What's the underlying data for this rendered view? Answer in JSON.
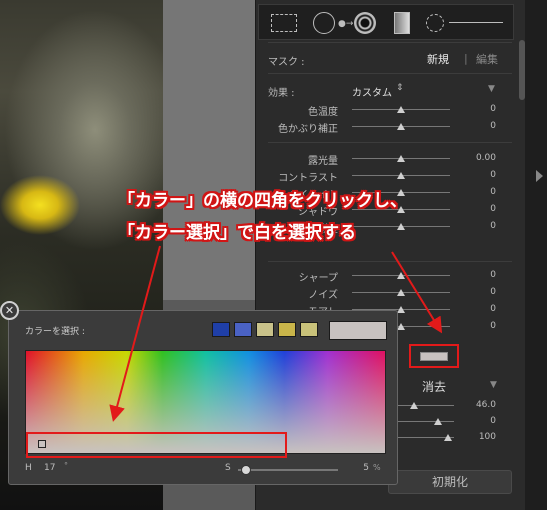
{
  "mask": {
    "label": "マスク :",
    "new": "新規",
    "separator": "|",
    "edit": "編集"
  },
  "effect": {
    "label": "効果 :",
    "value": "カスタム",
    "arrows": "⇕",
    "collapse": "▼",
    "rows": [
      {
        "label": "色温度",
        "value": "0",
        "pos": 0.5
      },
      {
        "label": "色かぶり補正",
        "value": "0",
        "pos": 0.5
      }
    ]
  },
  "tone": {
    "rows": [
      {
        "label": "露光量",
        "value": "0.00",
        "pos": 0.5
      },
      {
        "label": "コントラスト",
        "value": "0",
        "pos": 0.5
      },
      {
        "label": "ハイライト",
        "value": "0",
        "pos": 0.5
      },
      {
        "label": "シャドウ",
        "value": "0",
        "pos": 0.5
      },
      {
        "label": "彩度",
        "value": "0",
        "pos": 0.5
      }
    ]
  },
  "detail": {
    "rows": [
      {
        "label": "シャープ",
        "value": "0",
        "pos": 0.5
      },
      {
        "label": "ノイズ",
        "value": "0",
        "pos": 0.5
      },
      {
        "label": "モアレ",
        "value": "0",
        "pos": 0.5
      },
      {
        "label": "フリンジ",
        "value": "0",
        "pos": 0.5
      }
    ]
  },
  "brush": {
    "clear": "消去",
    "collapse": "▼",
    "values": [
      "46.0",
      "0",
      "100"
    ]
  },
  "reset_label": "初期化",
  "picker": {
    "close": "✕",
    "title": "カラーを選択 :",
    "presets": [
      "#1f3fa8",
      "#4a62c4",
      "#c9c28a",
      "#c9b54a",
      "#c9c27a"
    ],
    "current_color": "#c8c2c0",
    "h_label": "H",
    "h_value": "17",
    "h_unit": "°",
    "s_label": "S",
    "s_value": "5",
    "s_unit": "%"
  },
  "annotations": {
    "line1": "「カラー」の横の四角をクリックし、",
    "line2": "「カラー選択」で白を選択する"
  },
  "colors": {
    "highlight": "#e21a1a",
    "panel_bg": "#2b2b2b",
    "accent_text": "#e8e8e8"
  }
}
